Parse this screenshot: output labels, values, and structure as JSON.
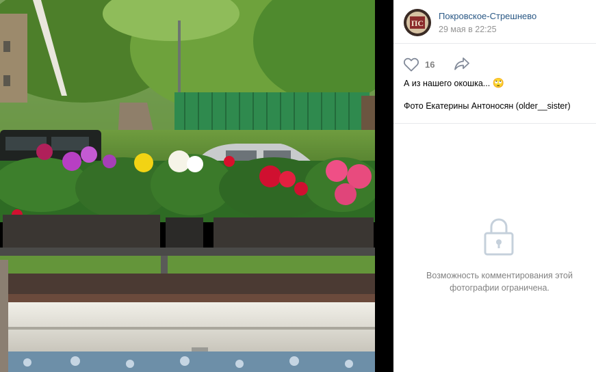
{
  "post": {
    "author": "Покровское-Стрешнево",
    "avatar_text": "ПС",
    "date": "29 мая в 22:25",
    "like_count": "16",
    "caption": "А из нашего окошка...",
    "caption_emoji": "🙄",
    "credit": "Фото Екатерины Антоносян (older__sister)",
    "comments_restricted": "Возможность комментирования этой фотографии ограничена."
  },
  "icons": {
    "like": "heart-outline-icon",
    "share": "share-arrow-icon",
    "lock": "lock-icon"
  },
  "colors": {
    "link": "#2a5885",
    "muted": "#939393",
    "icon": "#828a99",
    "lock": "#c5d0db",
    "divider": "#e7e8ec"
  }
}
